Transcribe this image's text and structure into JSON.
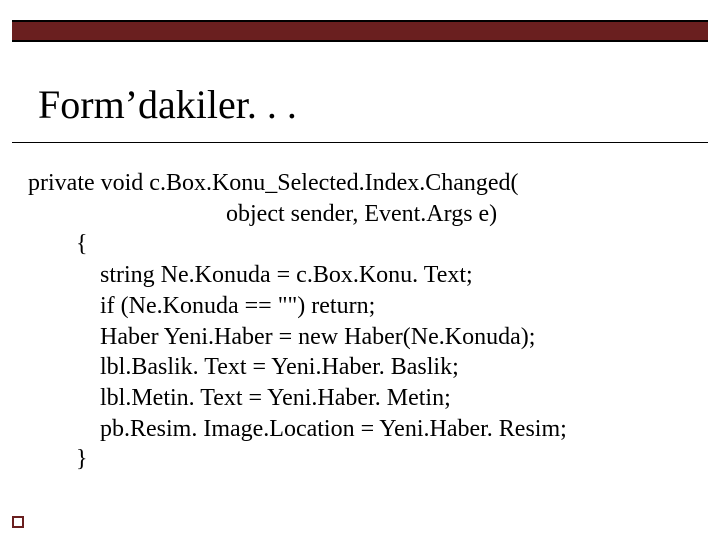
{
  "title": "Form’dakiler. . .",
  "code": {
    "l1": "private void c.Box.Konu_Selected.Index.Changed(",
    "l2": "                                 object sender, Event.Args e)",
    "l3": "        {",
    "l4": "            string Ne.Konuda = c.Box.Konu. Text;",
    "l5": "            if (Ne.Konuda == \"\") return;",
    "l6": "            Haber Yeni.Haber = new Haber(Ne.Konuda);",
    "l7": "            lbl.Baslik. Text = Yeni.Haber. Baslik;",
    "l8": "            lbl.Metin. Text = Yeni.Haber. Metin;",
    "l9": "            pb.Resim. Image.Location = Yeni.Haber. Resim;",
    "l10": "        }"
  }
}
